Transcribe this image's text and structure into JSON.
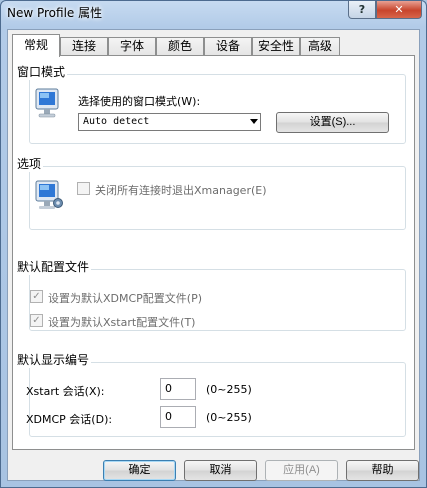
{
  "window": {
    "title": "New Profile 属性",
    "help_label": "?",
    "close_label": "✕"
  },
  "tabs": [
    {
      "label": "常规",
      "active": true
    },
    {
      "label": "连接"
    },
    {
      "label": "字体"
    },
    {
      "label": "颜色"
    },
    {
      "label": "设备"
    },
    {
      "label": "安全性"
    },
    {
      "label": "高级"
    }
  ],
  "window_mode": {
    "group_title": "窗口模式",
    "prompt": "选择使用的窗口模式(W):",
    "selected_value": "Auto detect",
    "settings_button": "设置(S)...",
    "icon": "monitor-icon"
  },
  "options": {
    "group_title": "选项",
    "exit_checkbox_label": "关闭所有连接时退出Xmanager(E)",
    "exit_checkbox_checked": false,
    "icon": "monitor-network-icon"
  },
  "default_profile": {
    "group_title": "默认配置文件",
    "xdmcp_label": "设置为默认XDMCP配置文件(P)",
    "xdmcp_checked": true,
    "xstart_label": "设置为默认Xstart配置文件(T)",
    "xstart_checked": true
  },
  "display_number": {
    "group_title": "默认显示编号",
    "xstart_label": "Xstart 会话(X):",
    "xstart_value": "0",
    "xstart_range": "(0~255)",
    "xdmcp_label": "XDMCP 会话(D):",
    "xdmcp_value": "0",
    "xdmcp_range": "(0~255)"
  },
  "footer": {
    "ok": "确定",
    "cancel": "取消",
    "apply": "应用(A)",
    "help": "帮助"
  },
  "colors": {
    "accent": "#3c7fb1",
    "close": "#c8452d",
    "panel_bg": "#ffffff"
  }
}
